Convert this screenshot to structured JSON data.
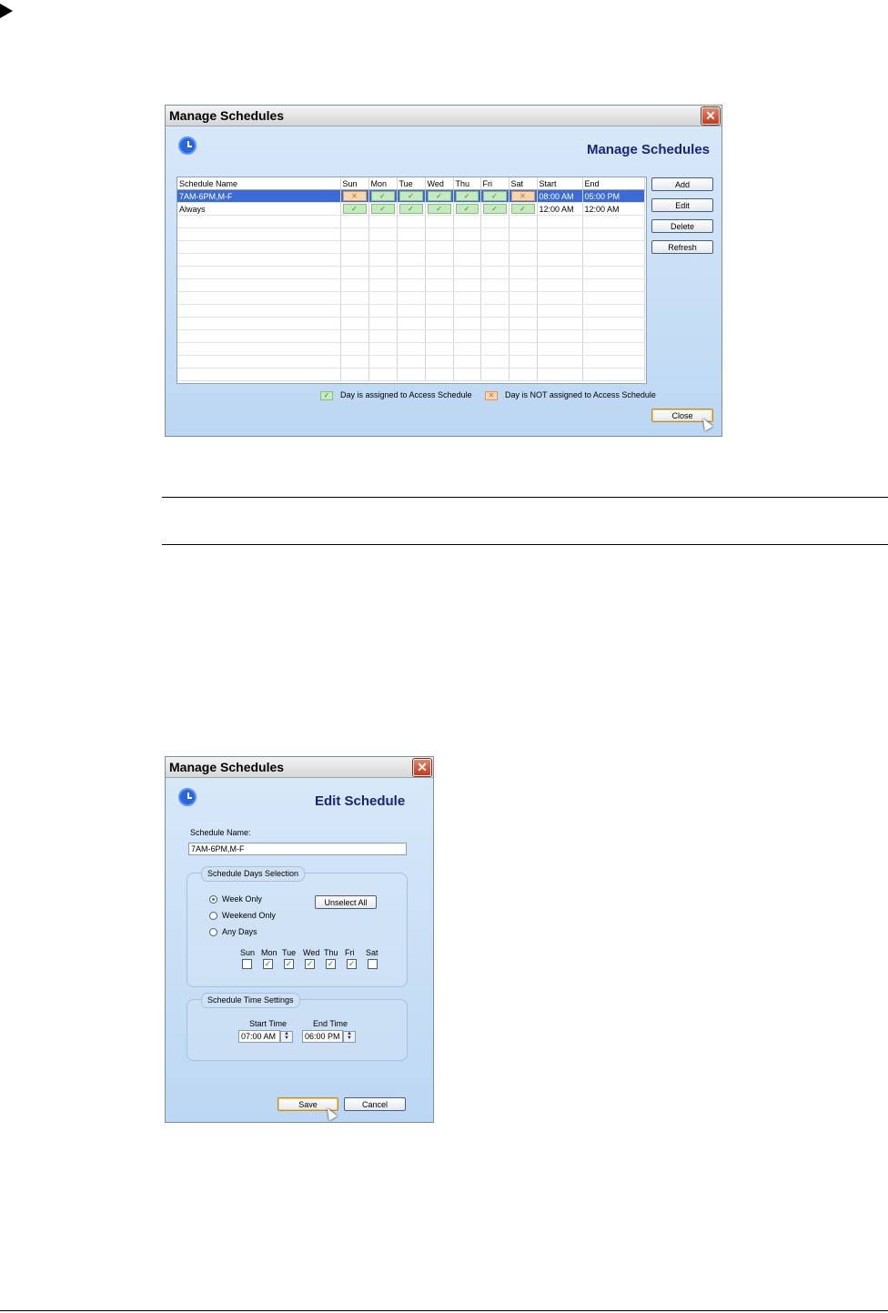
{
  "manage_dialog": {
    "title": "Manage Schedules",
    "header": "Manage Schedules",
    "close_glyph": "✕",
    "columns": [
      "Schedule Name",
      "Sun",
      "Mon",
      "Tue",
      "Wed",
      "Thu",
      "Fri",
      "Sat",
      "Start",
      "End"
    ],
    "rows": [
      {
        "name": "7AM-6PM,M-F",
        "days": [
          false,
          true,
          true,
          true,
          true,
          true,
          false
        ],
        "start": "08:00 AM",
        "end": "05:00 PM",
        "selected": true
      },
      {
        "name": "Always",
        "days": [
          true,
          true,
          true,
          true,
          true,
          true,
          true
        ],
        "start": "12:00 AM",
        "end": "12:00 AM",
        "selected": false
      }
    ],
    "buttons": {
      "add": "Add",
      "edit": "Edit",
      "delete": "Delete",
      "refresh": "Refresh",
      "close": "Close"
    },
    "legend": {
      "assigned": "Day is assigned to Access Schedule",
      "not_assigned": "Day is NOT assigned to Access Schedule"
    },
    "icons": {
      "yes": "✓",
      "no": "✕",
      "clock": "clock-icon"
    }
  },
  "edit_dialog": {
    "title": "Manage Schedules",
    "header": "Edit Schedule",
    "close_glyph": "✕",
    "name_label": "Schedule Name:",
    "name_value": "7AM-6PM,M-F",
    "days_group": "Schedule Days Selection",
    "options": [
      "Week Only",
      "Weekend Only",
      "Any Days"
    ],
    "selected_option": "Week Only",
    "unselect_all": "Unselect All",
    "days": [
      {
        "label": "Sun",
        "checked": false
      },
      {
        "label": "Mon",
        "checked": true
      },
      {
        "label": "Tue",
        "checked": true
      },
      {
        "label": "Wed",
        "checked": true
      },
      {
        "label": "Thu",
        "checked": true
      },
      {
        "label": "Fri",
        "checked": true
      },
      {
        "label": "Sat",
        "checked": false
      }
    ],
    "time_group": "Schedule Time Settings",
    "start_label": "Start Time",
    "start_value": "07:00 AM",
    "end_label": "End Time",
    "end_value": "06:00 PM",
    "save": "Save",
    "cancel": "Cancel"
  },
  "colors": {
    "header_text": "#1a237e",
    "selection": "#3b6cd6",
    "assigned": "#c6e9c0",
    "not_assigned": "#f8d6b2"
  }
}
